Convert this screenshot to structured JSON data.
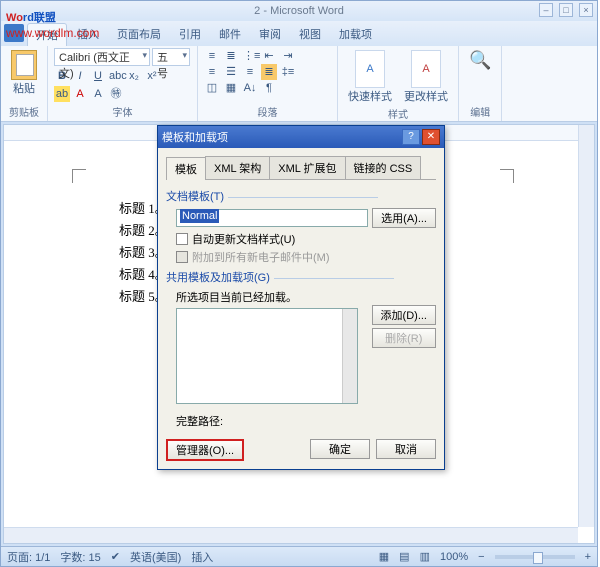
{
  "watermark": {
    "line1a": "W",
    "line1b": "o",
    "line1c": "rd联盟",
    "line2": "www.wordlm.com"
  },
  "title": "2 - Microsoft Word",
  "tabs": {
    "t0": "文件",
    "t1": "开始",
    "t2": "插入",
    "t3": "页面布局",
    "t4": "引用",
    "t5": "邮件",
    "t6": "审阅",
    "t7": "视图",
    "t8": "加载项"
  },
  "font": {
    "name": "Calibri (西文正文)",
    "size": "五号"
  },
  "groups": {
    "clipboard": "剪贴板",
    "font": "字体",
    "paragraph": "段落",
    "styles": "样式",
    "editing": "编辑"
  },
  "bigbtns": {
    "paste": "粘贴",
    "quickstyle": "快速样式",
    "changestyle": "更改样式"
  },
  "headings": {
    "h1": "标题 1。",
    "h2": "标题 2。",
    "h3": "标题 3。",
    "h4": "标题 4。",
    "h5": "标题 5。"
  },
  "status": {
    "page": "页面: 1/1",
    "words": "字数: 15",
    "lang": "英语(美国)",
    "mode": "插入",
    "zoom": "100%"
  },
  "dialog": {
    "title": "模板和加载项",
    "tabs": {
      "t1": "模板",
      "t2": "XML 架构",
      "t3": "XML 扩展包",
      "t4": "链接的 CSS"
    },
    "doc_template_label": "文档模板(T)",
    "template_value": "Normal",
    "btn_select": "选用(A)...",
    "cb_auto": "自动更新文档样式(U)",
    "cb_attach": "附加到所有新电子邮件中(M)",
    "shared_label": "共用模板及加载项(G)",
    "shared_hint": "所选项目当前已经加载。",
    "btn_add": "添加(D)...",
    "btn_remove": "删除(R)",
    "full_path": "完整路径:",
    "btn_manager": "管理器(O)...",
    "btn_ok": "确定",
    "btn_cancel": "取消"
  }
}
